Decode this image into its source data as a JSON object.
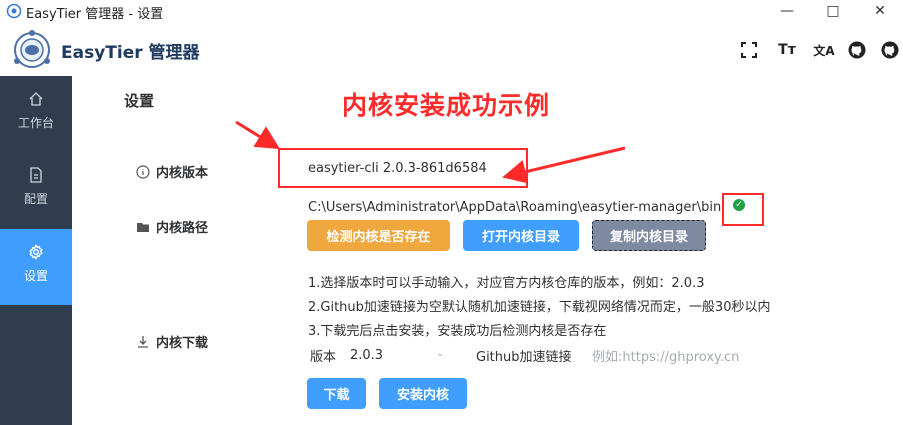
{
  "window": {
    "title": "EasyTier 管理器 - 设置",
    "minimize_glyph": "—",
    "maximize_glyph": "□",
    "close_glyph": "✕"
  },
  "header": {
    "brand": "EasyTier 管理器",
    "icons": [
      "fullscreen-icon",
      "font-size-icon",
      "translate-icon",
      "github-icon",
      "github-icon"
    ],
    "font_icon_text": "Tт",
    "translate_icon_text": "文A"
  },
  "sidebar": {
    "items": [
      {
        "label": "工作台",
        "icon": "home-icon",
        "active": false
      },
      {
        "label": "配置",
        "icon": "config-file-icon",
        "active": false
      },
      {
        "label": "设置",
        "icon": "gear-icon",
        "active": true
      }
    ]
  },
  "main": {
    "title": "设置",
    "annotation": "内核安装成功示例",
    "version_label": "内核版本",
    "version_value": "easytier-cli 2.0.3-861d6584",
    "path_label": "内核路径",
    "path_value": "C:\\Users\\Administrator\\AppData\\Roaming\\easytier-manager\\bin",
    "path_status": "✓",
    "buttons": {
      "check": "检测内核是否存在",
      "open": "打开内核目录",
      "copy": "复制内核目录"
    },
    "download_label": "内核下载",
    "notes": [
      "1.选择版本时可以手动输入，对应官方内核仓库的版本，例如：2.0.3",
      "2.Github加速链接为空默认随机加速链接，下载视网络情况而定，一般30秒以内",
      "3.下载完后点击安装，安装成功后检测内核是否存在"
    ],
    "version_field_label": "版本",
    "version_select_value": "2.0.3",
    "github_label": "Github加速链接",
    "github_placeholder": "例如:https://ghproxy.cn",
    "download_button": "下载",
    "install_button": "安装内核"
  },
  "colors": {
    "accent": "#409eff",
    "warning": "#f0a73e",
    "sidebar_bg": "#2f3d4f",
    "annotation_red": "#ff2a2a",
    "success": "#22a046"
  }
}
